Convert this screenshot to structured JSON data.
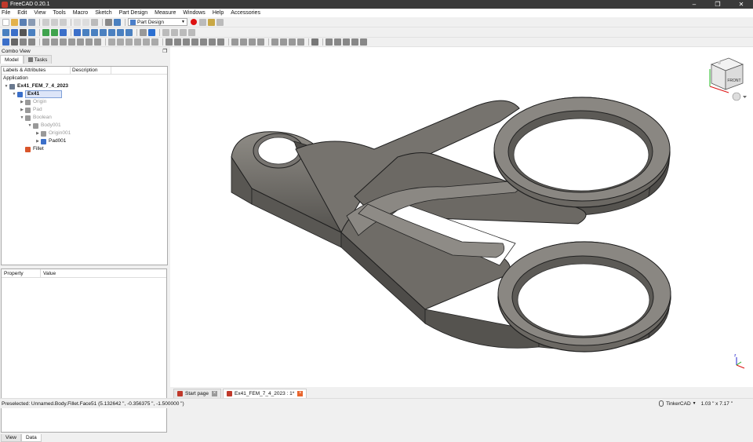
{
  "window": {
    "title": "FreeCAD 0.20.1",
    "controls": [
      "–",
      "❐",
      "✕"
    ]
  },
  "menu": [
    "File",
    "Edit",
    "View",
    "Tools",
    "Macro",
    "Sketch",
    "Part Design",
    "Measure",
    "Windows",
    "Help",
    "Accessories"
  ],
  "toolbar": {
    "workbench": "Part Design"
  },
  "combo_view": {
    "title": "Combo View",
    "tabs": [
      "Model",
      "Tasks"
    ],
    "tree_headers": [
      "Labels & Attributes",
      "Description"
    ],
    "tree": [
      {
        "label": "Application",
        "depth": 0,
        "expander": "",
        "icon": ""
      },
      {
        "label": "Ex41_FEM_7_4_2023",
        "depth": 0,
        "expander": "v",
        "icon": "#6b7a8f",
        "bold": true
      },
      {
        "label": "Ex41",
        "depth": 1,
        "expander": "v",
        "icon": "#3b6fc9",
        "selected": true,
        "bold": true
      },
      {
        "label": "Origin",
        "depth": 2,
        "expander": ">",
        "icon": "#999",
        "dim": true
      },
      {
        "label": "Pad",
        "depth": 2,
        "expander": ">",
        "icon": "#999",
        "dim": true
      },
      {
        "label": "Boolean",
        "depth": 2,
        "expander": "v",
        "icon": "#999",
        "dim": true
      },
      {
        "label": "Body001",
        "depth": 3,
        "expander": "v",
        "icon": "#999",
        "dim": true
      },
      {
        "label": "Origin001",
        "depth": 4,
        "expander": ">",
        "icon": "#999",
        "dim": true
      },
      {
        "label": "Pad001",
        "depth": 4,
        "expander": ">",
        "icon": "#3b6fc9"
      },
      {
        "label": "Fillet",
        "depth": 2,
        "expander": "",
        "icon": "#d9552b"
      }
    ],
    "property_headers": [
      "Property",
      "Value"
    ],
    "bottom_tabs": [
      "View",
      "Data"
    ]
  },
  "navcube": {
    "face": "FRONT"
  },
  "doc_tabs": [
    "Start page",
    "Ex41_FEM_7_4_2023 : 1*"
  ],
  "statusbar": {
    "message": "Preselected: Unnamed.Body.Fillet.Face51 (5.132642 \", -0.356375 \", -1.500000 \")",
    "nav_style": "TinkerCAD",
    "dimensions": "1.03 \" x 7.17 \""
  },
  "colors": {
    "model_fill": "#6e6b66",
    "selection": "#dde5f8"
  }
}
